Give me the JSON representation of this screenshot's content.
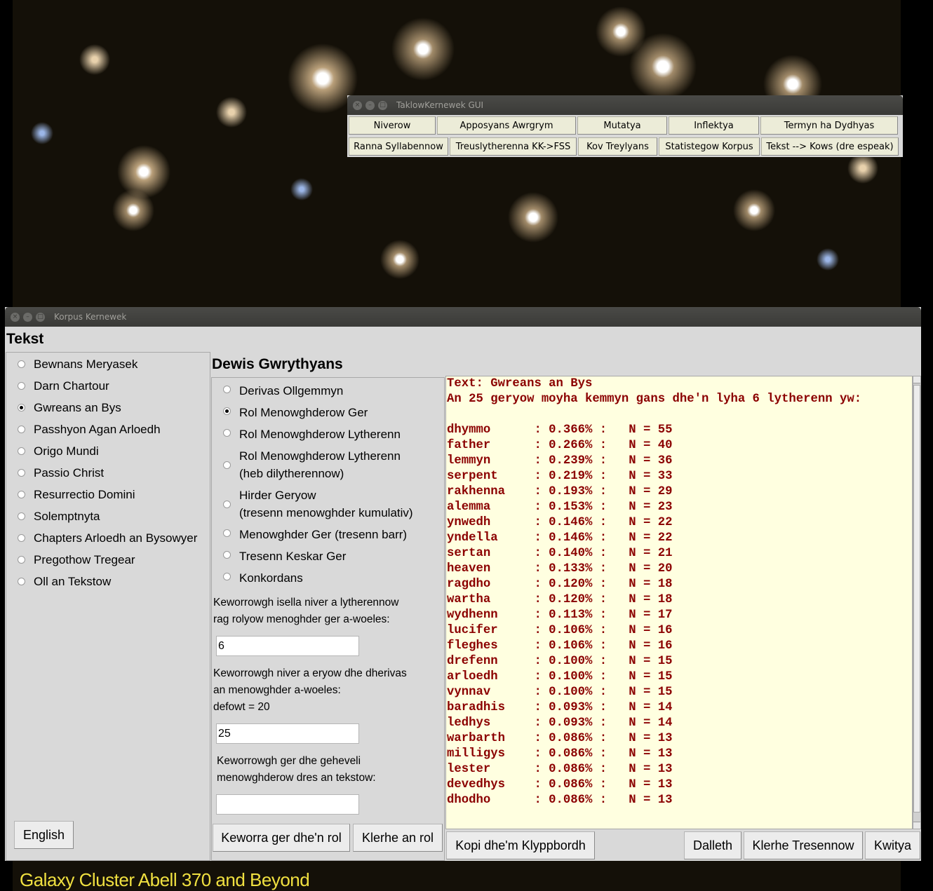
{
  "wallpaper": {
    "caption": "Galaxy Cluster Abell 370 and Beyond"
  },
  "taklow": {
    "title": "TaklowKernewek GUI",
    "row1": [
      "Niverow",
      "Apposyans Awrgrym",
      "Mutatya",
      "Inflektya",
      "Termyn ha Dydhyas"
    ],
    "row2": [
      "Ranna Syllabennow",
      "Treuslytherenna KK->FSS",
      "Kov Treylyans",
      "Statistegow Korpus",
      "Tekst --> Kows (dre espeak)"
    ]
  },
  "korpus": {
    "title": "Korpus Kernewek",
    "tekst_heading": "Tekst",
    "texts": [
      "Bewnans Meryasek",
      "Darn Chartour",
      "Gwreans an Bys",
      "Passhyon Agan Arloedh",
      "Origo Mundi",
      "Passio Christ",
      "Resurrectio Domini",
      "Solemptnyta",
      "Chapters Arloedh an Bysowyer",
      "Pregothow Tregear",
      "Oll an Tekstow"
    ],
    "selected_text": 2,
    "english_button": "English",
    "dewis_heading": "Dewis Gwrythyans",
    "actions": [
      [
        "Derivas Ollgemmyn"
      ],
      [
        "Rol Menowghderow Ger"
      ],
      [
        "Rol Menowghderow Lytherenn"
      ],
      [
        "Rol Menowghderow Lytherenn",
        "(heb dilytherennow)"
      ],
      [
        "Hirder Geryow",
        "(tresenn menowghder kumulativ)"
      ],
      [
        "Menowghder Ger (tresenn barr)"
      ],
      [
        "Tresenn Keskar Ger"
      ],
      [
        "Konkordans"
      ]
    ],
    "selected_action": 1,
    "min_letters_label": [
      "Keworrowgh isella niver a lytherennow",
      "rag rolyow menoghder ger a-woeles:"
    ],
    "min_letters_value": "6",
    "num_words_label": [
      "Keworrowgh niver a eryow dhe dherivas",
      "an menowghder a-woeles:",
      "defowt = 20"
    ],
    "num_words_value": "25",
    "compare_label": [
      "Keworrowgh ger dhe geheveli",
      "menowghderow dres an tekstow:"
    ],
    "compare_value": "",
    "add_word_button": "Keworra ger dhe'n rol",
    "clear_list_button": "Klerhe an rol",
    "copy_button": "Kopi dhe'm Klyppbordh",
    "start_button": "Dalleth",
    "clear_plots_button": "Klerhe Tresennow",
    "quit_button": "Kwitya",
    "output": {
      "header1": "Text: Gwreans an Bys",
      "header2": "An 25 geryow moyha kemmyn gans dhe'n lyha 6 lytherenn yw:",
      "rows": [
        [
          "dhymmo",
          "0.366%",
          "55"
        ],
        [
          "father",
          "0.266%",
          "40"
        ],
        [
          "lemmyn",
          "0.239%",
          "36"
        ],
        [
          "serpent",
          "0.219%",
          "33"
        ],
        [
          "rakhenna",
          "0.193%",
          "29"
        ],
        [
          "alemma",
          "0.153%",
          "23"
        ],
        [
          "ynwedh",
          "0.146%",
          "22"
        ],
        [
          "yndella",
          "0.146%",
          "22"
        ],
        [
          "sertan",
          "0.140%",
          "21"
        ],
        [
          "heaven",
          "0.133%",
          "20"
        ],
        [
          "ragdho",
          "0.120%",
          "18"
        ],
        [
          "wartha",
          "0.120%",
          "18"
        ],
        [
          "wydhenn",
          "0.113%",
          "17"
        ],
        [
          "lucifer",
          "0.106%",
          "16"
        ],
        [
          "fleghes",
          "0.106%",
          "16"
        ],
        [
          "drefenn",
          "0.100%",
          "15"
        ],
        [
          "arloedh",
          "0.100%",
          "15"
        ],
        [
          "vynnav",
          "0.100%",
          "15"
        ],
        [
          "baradhis",
          "0.093%",
          "14"
        ],
        [
          "ledhys",
          "0.093%",
          "14"
        ],
        [
          "warbarth",
          "0.086%",
          "13"
        ],
        [
          "milligys",
          "0.086%",
          "13"
        ],
        [
          "lester",
          "0.086%",
          "13"
        ],
        [
          "devedhys",
          "0.086%",
          "13"
        ],
        [
          "dhodho",
          "0.086%",
          "13"
        ]
      ]
    }
  }
}
